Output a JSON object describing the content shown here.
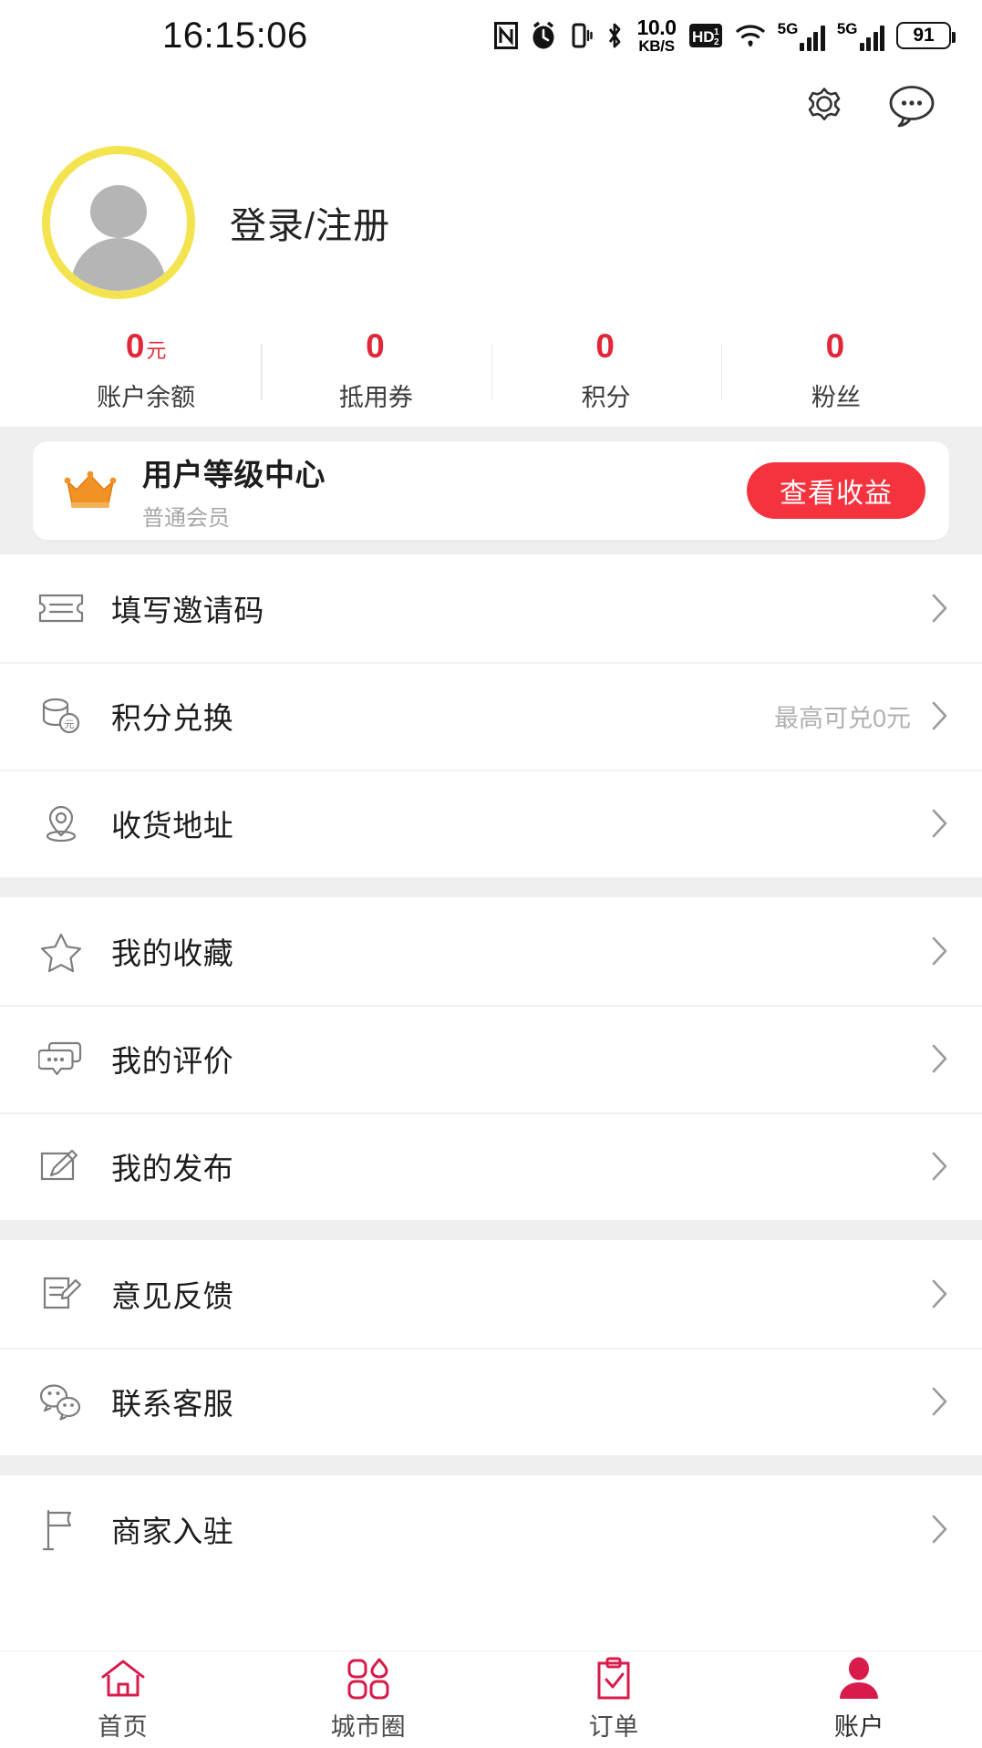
{
  "status_bar": {
    "time": "16:15:06",
    "net_speed_value": "10.0",
    "net_speed_unit": "KB/S",
    "hd_label": "HD",
    "signal_label_1": "5G",
    "signal_label_2": "5G",
    "battery": "91",
    "icons": [
      "nfc-icon",
      "alarm-icon",
      "vibrate-icon",
      "bluetooth-icon",
      "network-speed",
      "hd-icon",
      "wifi-icon",
      "signal-5g-icon",
      "signal-5g-icon",
      "battery-icon"
    ]
  },
  "header": {
    "settings_label": "设置",
    "messages_label": "消息"
  },
  "profile": {
    "login_text": "登录/注册",
    "avatar_ring_color": "#f3e34e"
  },
  "stats": {
    "items": [
      {
        "value": "0",
        "unit": "元",
        "label": "账户余额"
      },
      {
        "value": "0",
        "unit": "",
        "label": "抵用券"
      },
      {
        "value": "0",
        "unit": "",
        "label": "积分"
      },
      {
        "value": "0",
        "unit": "",
        "label": "粉丝"
      }
    ],
    "value_color": "#e0283a"
  },
  "vip_card": {
    "title": "用户等级中心",
    "subtitle": "普通会员",
    "button_label": "查看收益",
    "button_color": "#f5333f",
    "crown_color": "#f08c1e"
  },
  "menu_groups": [
    {
      "rows": [
        {
          "icon": "ticket-icon",
          "label": "填写邀请码",
          "hint": ""
        },
        {
          "icon": "coin-stack-icon",
          "label": "积分兑换",
          "hint": "最高可兑0元"
        },
        {
          "icon": "location-pin-icon",
          "label": "收货地址",
          "hint": ""
        }
      ]
    },
    {
      "rows": [
        {
          "icon": "star-icon",
          "label": "我的收藏",
          "hint": ""
        },
        {
          "icon": "comment-icon",
          "label": "我的评价",
          "hint": ""
        },
        {
          "icon": "edit-note-icon",
          "label": "我的发布",
          "hint": ""
        }
      ]
    },
    {
      "rows": [
        {
          "icon": "feedback-icon",
          "label": "意见反馈",
          "hint": ""
        },
        {
          "icon": "wechat-bubbles-icon",
          "label": "联系客服",
          "hint": ""
        }
      ]
    },
    {
      "rows": [
        {
          "icon": "flag-icon",
          "label": "商家入驻",
          "hint": ""
        }
      ]
    }
  ],
  "tabbar": {
    "accent_color": "#d81b4a",
    "items": [
      {
        "icon": "home-icon",
        "label": "首页",
        "active": false
      },
      {
        "icon": "city-circle-icon",
        "label": "城市圈",
        "active": false
      },
      {
        "icon": "clipboard-check-icon",
        "label": "订单",
        "active": false
      },
      {
        "icon": "user-filled-icon",
        "label": "账户",
        "active": true
      }
    ]
  }
}
